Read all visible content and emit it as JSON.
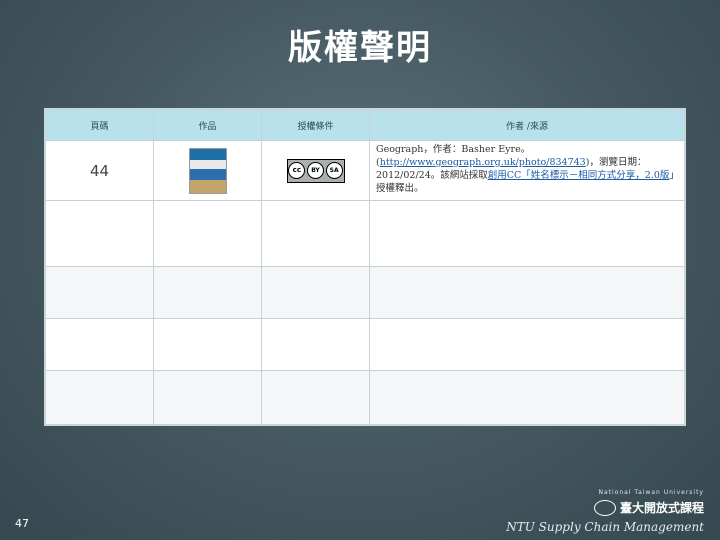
{
  "title": "版權聲明",
  "table": {
    "headers": [
      "頁碼",
      "作品",
      "授權條件",
      "作者 /來源"
    ],
    "rows": [
      {
        "page": "44",
        "source_text_1": "Geograph，作者：Basher Eyre。(",
        "source_link": "http://www.geograph.org.uk/photo/834743",
        "source_text_2": ")，瀏覽日期：2012/02/24。該網站採取",
        "license_link": "創用CC「姓名標示－相同方式分享，2.0版",
        "source_text_3": "」授權釋出。"
      }
    ]
  },
  "license_icon": {
    "cc": "cc",
    "by": "BY",
    "sa": "SA"
  },
  "footer": {
    "page_number": "47",
    "logo_tagline": "National Taiwan University",
    "logo_name": "臺大開放式課程",
    "course_name": "NTU Supply Chain Management"
  }
}
